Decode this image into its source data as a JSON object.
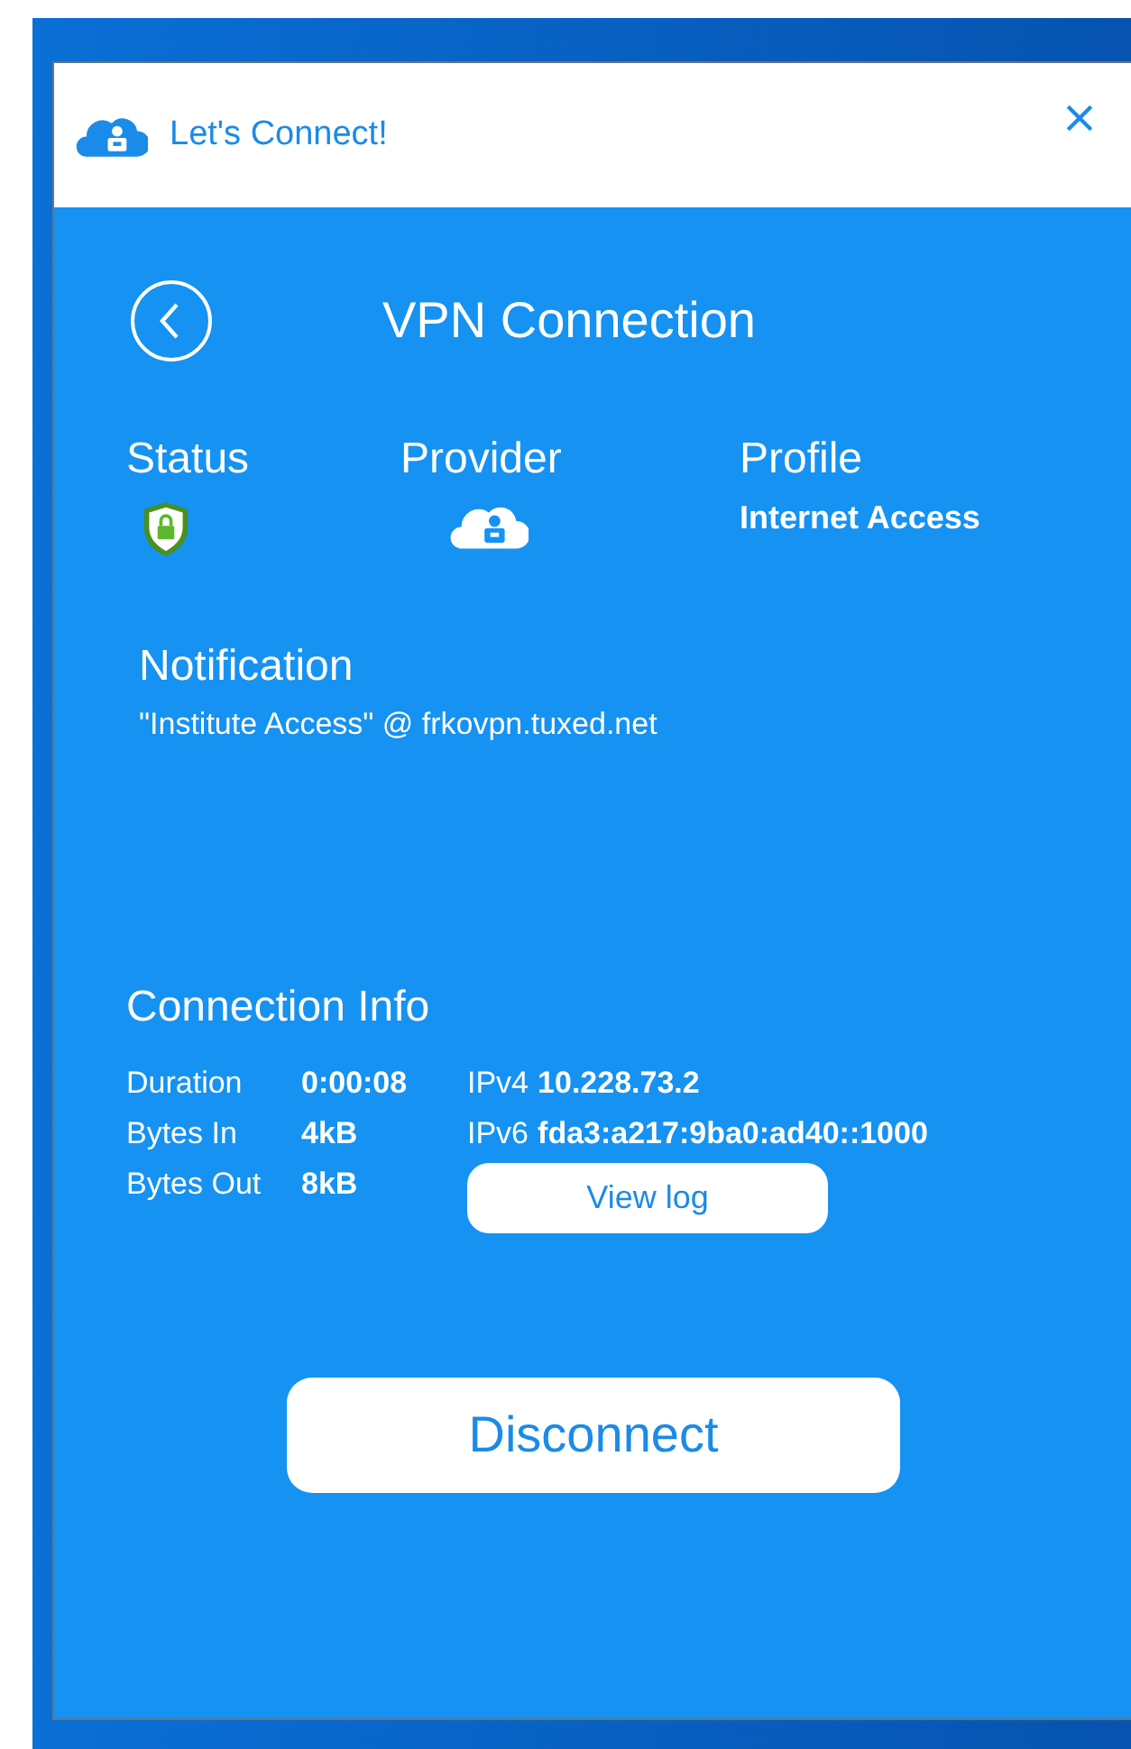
{
  "window": {
    "title": "Let's Connect!"
  },
  "header": {
    "title": "VPN Connection"
  },
  "summary": [
    {
      "kind": "shield",
      "label": "Status"
    },
    {
      "kind": "cloud",
      "label": "Provider"
    },
    {
      "kind": "text",
      "label": "Profile",
      "value": "Internet Access"
    }
  ],
  "notification": {
    "title": "Notification",
    "text": "\"Institute Access\" @ frkovpn.tuxed.net"
  },
  "connection_info": {
    "title": "Connection Info",
    "left": [
      {
        "label": "Duration",
        "value": "0:00:08"
      },
      {
        "label": "Bytes In",
        "value": "4kB"
      },
      {
        "label": "Bytes Out",
        "value": "8kB"
      }
    ],
    "right": [
      {
        "label": "IPv4",
        "value": "10.228.73.2"
      },
      {
        "label": "IPv6",
        "value": "fda3:a217:9ba0:ad40::1000"
      }
    ],
    "view_log": {
      "label": "View log"
    }
  },
  "disconnect": {
    "label": "Disconnect"
  }
}
